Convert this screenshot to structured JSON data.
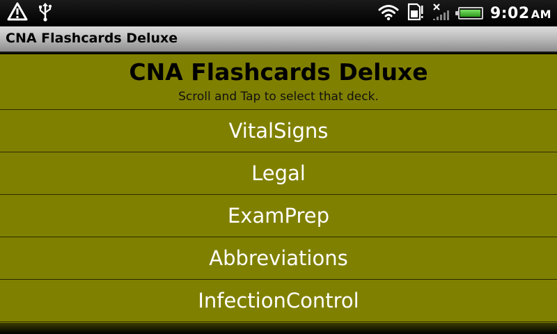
{
  "status_bar": {
    "time": "9:02",
    "time_suffix": "AM",
    "icons": [
      "warning-icon",
      "usb-icon",
      "wifi-icon",
      "sd-card-icon",
      "no-signal-icon",
      "battery-icon"
    ],
    "battery_level": 0.9
  },
  "app": {
    "title": "CNA Flashcards Deluxe"
  },
  "header": {
    "title": "CNA Flashcards Deluxe",
    "subtitle": "Scroll and Tap to select that deck."
  },
  "decks": [
    {
      "label": "VitalSigns"
    },
    {
      "label": "Legal"
    },
    {
      "label": "ExamPrep"
    },
    {
      "label": "Abbreviations"
    },
    {
      "label": "InfectionControl"
    }
  ],
  "colors": {
    "background": "#808000",
    "deck_text": "#ffffff",
    "header_text": "#000000"
  }
}
